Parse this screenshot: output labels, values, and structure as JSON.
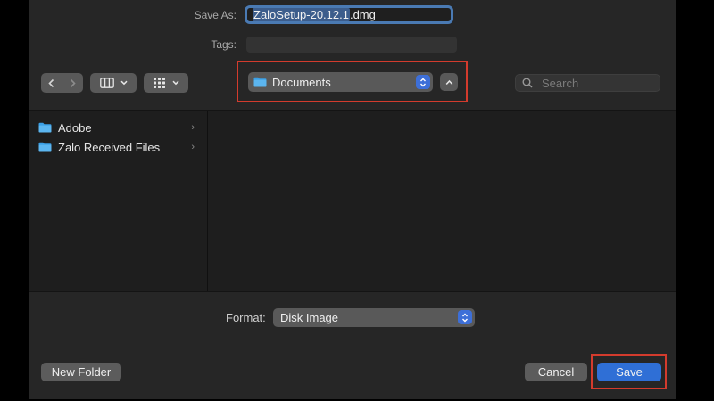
{
  "dialog": {
    "save_as_label": "Save As:",
    "filename_selected": "ZaloSetup-20.12.1",
    "filename_extension": ".dmg",
    "tags_label": "Tags:",
    "tags_value": ""
  },
  "toolbar": {
    "back_icon": "chevron-left-icon",
    "forward_icon": "chevron-right-icon",
    "view_columns_icon": "column-view-icon",
    "view_grid_icon": "grid-view-icon",
    "location": "Documents",
    "expand_icon": "chevron-up-icon",
    "search_placeholder": "Search"
  },
  "browser": {
    "items": [
      {
        "label": "Adobe",
        "icon": "folder-icon"
      },
      {
        "label": "Zalo Received Files",
        "icon": "folder-icon"
      }
    ]
  },
  "format": {
    "label": "Format:",
    "value": "Disk Image"
  },
  "buttons": {
    "new_folder": "New Folder",
    "cancel": "Cancel",
    "save": "Save"
  },
  "colors": {
    "dialog_bg": "#262626",
    "accent": "#2f6fd6",
    "highlight": "#d33b2d",
    "folder": "#3aa0e6"
  }
}
